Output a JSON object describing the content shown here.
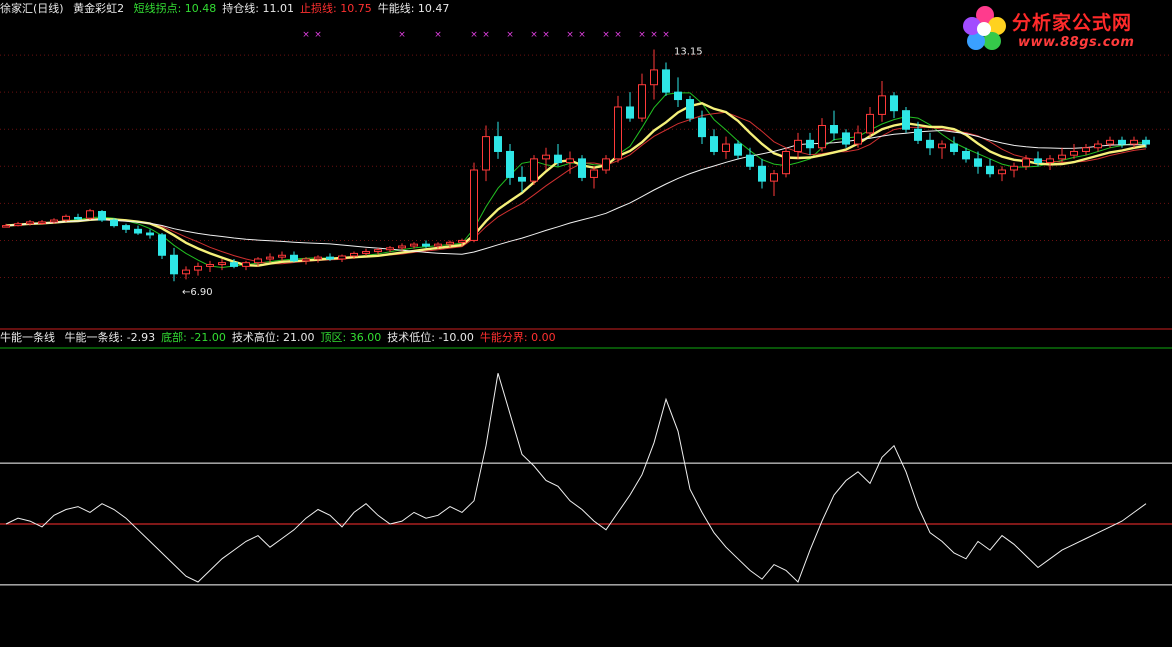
{
  "header_top": {
    "title": "徐家汇(日线)",
    "indicator": "黄金彩虹2",
    "items": [
      {
        "label": "短线拐点: ",
        "value": "10.48",
        "color": "#33dd33"
      },
      {
        "label": "持仓线: ",
        "value": "11.01",
        "color": "#e8e8e8"
      },
      {
        "label": "止损线: ",
        "value": "10.75",
        "color": "#ff3030"
      },
      {
        "label": "牛能线: ",
        "value": "10.47",
        "color": "#e8e8e8"
      }
    ]
  },
  "header_bottom": {
    "title": "牛能一条线",
    "items": [
      {
        "label": "牛能一条线: ",
        "value": "-2.93",
        "color": "#e8e8e8"
      },
      {
        "label": "底部: ",
        "value": "-21.00",
        "color": "#33dd33"
      },
      {
        "label": "技术高位: ",
        "value": "21.00",
        "color": "#e8e8e8"
      },
      {
        "label": "顶区: ",
        "value": "36.00",
        "color": "#33dd33"
      },
      {
        "label": "技术低位: ",
        "value": "-10.00",
        "color": "#e8e8e8"
      },
      {
        "label": "牛能分界: ",
        "value": "0.00",
        "color": "#ff3030"
      }
    ]
  },
  "logo": {
    "brand": "分析家公式网",
    "url": "www.88gs.com"
  },
  "chart_data": [
    {
      "type": "candlestick",
      "n_bars": 96,
      "ylim": [
        5.8,
        14.0
      ],
      "grid": "horizontal dotted red",
      "annotations": [
        {
          "text": "13.15",
          "bar": 55,
          "value": 13.15
        },
        {
          "text": "←6.90",
          "bar": 14,
          "value": 6.9
        }
      ],
      "marker_glyph": "×",
      "markers_bars": [
        25,
        26,
        33,
        36,
        39,
        40,
        42,
        44,
        45,
        47,
        48,
        50,
        51,
        53,
        54,
        55
      ],
      "candles": [
        [
          8.4,
          8.45,
          8.35,
          8.4
        ],
        [
          8.4,
          8.5,
          8.38,
          8.45
        ],
        [
          8.45,
          8.55,
          8.4,
          8.5
        ],
        [
          8.48,
          8.55,
          8.42,
          8.5
        ],
        [
          8.5,
          8.6,
          8.45,
          8.55
        ],
        [
          8.55,
          8.7,
          8.5,
          8.65
        ],
        [
          8.62,
          8.72,
          8.55,
          8.6
        ],
        [
          8.6,
          8.85,
          8.55,
          8.8
        ],
        [
          8.78,
          8.82,
          8.5,
          8.55
        ],
        [
          8.55,
          8.6,
          8.35,
          8.4
        ],
        [
          8.4,
          8.45,
          8.2,
          8.3
        ],
        [
          8.3,
          8.4,
          8.15,
          8.2
        ],
        [
          8.2,
          8.3,
          8.05,
          8.15
        ],
        [
          8.15,
          8.2,
          7.5,
          7.6
        ],
        [
          7.6,
          7.8,
          6.9,
          7.1
        ],
        [
          7.1,
          7.3,
          6.95,
          7.2
        ],
        [
          7.2,
          7.4,
          7.05,
          7.3
        ],
        [
          7.3,
          7.45,
          7.15,
          7.35
        ],
        [
          7.35,
          7.5,
          7.2,
          7.4
        ],
        [
          7.4,
          7.5,
          7.25,
          7.3
        ],
        [
          7.3,
          7.45,
          7.2,
          7.4
        ],
        [
          7.4,
          7.55,
          7.3,
          7.5
        ],
        [
          7.5,
          7.65,
          7.4,
          7.55
        ],
        [
          7.55,
          7.7,
          7.45,
          7.6
        ],
        [
          7.6,
          7.7,
          7.4,
          7.45
        ],
        [
          7.45,
          7.55,
          7.35,
          7.5
        ],
        [
          7.5,
          7.6,
          7.4,
          7.55
        ],
        [
          7.55,
          7.65,
          7.45,
          7.5
        ],
        [
          7.5,
          7.62,
          7.42,
          7.58
        ],
        [
          7.58,
          7.7,
          7.5,
          7.65
        ],
        [
          7.65,
          7.78,
          7.58,
          7.7
        ],
        [
          7.7,
          7.8,
          7.62,
          7.75
        ],
        [
          7.75,
          7.85,
          7.68,
          7.8
        ],
        [
          7.8,
          7.92,
          7.72,
          7.85
        ],
        [
          7.85,
          7.95,
          7.78,
          7.9
        ],
        [
          7.9,
          8.0,
          7.8,
          7.85
        ],
        [
          7.85,
          7.95,
          7.78,
          7.9
        ],
        [
          7.9,
          8.0,
          7.82,
          7.95
        ],
        [
          7.95,
          8.05,
          7.85,
          8.0
        ],
        [
          8.0,
          10.1,
          7.95,
          9.9
        ],
        [
          9.9,
          11.1,
          9.6,
          10.8
        ],
        [
          10.8,
          11.2,
          10.2,
          10.4
        ],
        [
          10.4,
          10.6,
          9.5,
          9.7
        ],
        [
          9.7,
          10.0,
          9.3,
          9.6
        ],
        [
          9.6,
          10.3,
          9.5,
          10.2
        ],
        [
          10.2,
          10.5,
          9.9,
          10.3
        ],
        [
          10.3,
          10.6,
          10.0,
          10.1
        ],
        [
          10.1,
          10.4,
          9.8,
          10.2
        ],
        [
          10.2,
          10.3,
          9.6,
          9.7
        ],
        [
          9.7,
          10.0,
          9.4,
          9.9
        ],
        [
          9.9,
          10.3,
          9.8,
          10.2
        ],
        [
          10.2,
          11.9,
          10.1,
          11.6
        ],
        [
          11.6,
          12.0,
          11.2,
          11.3
        ],
        [
          11.3,
          12.5,
          11.2,
          12.2
        ],
        [
          12.2,
          13.15,
          11.8,
          12.6
        ],
        [
          12.6,
          12.8,
          11.9,
          12.0
        ],
        [
          12.0,
          12.4,
          11.6,
          11.8
        ],
        [
          11.8,
          11.9,
          11.2,
          11.3
        ],
        [
          11.3,
          11.5,
          10.6,
          10.8
        ],
        [
          10.8,
          11.0,
          10.3,
          10.4
        ],
        [
          10.4,
          10.8,
          10.2,
          10.6
        ],
        [
          10.6,
          10.7,
          10.2,
          10.3
        ],
        [
          10.3,
          10.5,
          9.9,
          10.0
        ],
        [
          10.0,
          10.2,
          9.4,
          9.6
        ],
        [
          9.6,
          9.9,
          9.2,
          9.8
        ],
        [
          9.8,
          10.5,
          9.7,
          10.4
        ],
        [
          10.4,
          10.9,
          10.2,
          10.7
        ],
        [
          10.7,
          10.9,
          10.3,
          10.5
        ],
        [
          10.5,
          11.3,
          10.4,
          11.1
        ],
        [
          11.1,
          11.5,
          10.7,
          10.9
        ],
        [
          10.9,
          11.0,
          10.5,
          10.6
        ],
        [
          10.6,
          11.1,
          10.5,
          10.9
        ],
        [
          10.9,
          11.6,
          10.8,
          11.4
        ],
        [
          11.4,
          12.3,
          11.2,
          11.9
        ],
        [
          11.9,
          12.0,
          11.3,
          11.5
        ],
        [
          11.5,
          11.6,
          10.9,
          11.0
        ],
        [
          11.0,
          11.2,
          10.6,
          10.7
        ],
        [
          10.7,
          10.9,
          10.3,
          10.5
        ],
        [
          10.5,
          10.7,
          10.2,
          10.6
        ],
        [
          10.6,
          10.8,
          10.3,
          10.4
        ],
        [
          10.4,
          10.5,
          10.1,
          10.2
        ],
        [
          10.2,
          10.4,
          9.8,
          10.0
        ],
        [
          10.0,
          10.2,
          9.7,
          9.8
        ],
        [
          9.8,
          10.0,
          9.6,
          9.9
        ],
        [
          9.9,
          10.1,
          9.7,
          10.0
        ],
        [
          10.0,
          10.3,
          9.9,
          10.2
        ],
        [
          10.2,
          10.4,
          10.0,
          10.1
        ],
        [
          10.1,
          10.3,
          9.9,
          10.2
        ],
        [
          10.2,
          10.5,
          10.1,
          10.3
        ],
        [
          10.3,
          10.6,
          10.2,
          10.4
        ],
        [
          10.4,
          10.6,
          10.3,
          10.5
        ],
        [
          10.5,
          10.7,
          10.4,
          10.6
        ],
        [
          10.6,
          10.8,
          10.5,
          10.7
        ],
        [
          10.7,
          10.8,
          10.5,
          10.6
        ],
        [
          10.6,
          10.8,
          10.5,
          10.7
        ],
        [
          10.7,
          10.8,
          10.5,
          10.6
        ]
      ]
    },
    {
      "type": "line",
      "name": "牛能一条线",
      "ylim": [
        -40,
        60
      ],
      "reference_lines": [
        {
          "value": 21,
          "color": "#ffffff"
        },
        {
          "value": 0,
          "color": "#ff3030"
        },
        {
          "value": -21,
          "color": "#ffffff"
        }
      ],
      "values": [
        0,
        2,
        1,
        -1,
        3,
        5,
        6,
        4,
        7,
        5,
        2,
        -2,
        -6,
        -10,
        -14,
        -18,
        -20,
        -16,
        -12,
        -9,
        -6,
        -4,
        -8,
        -5,
        -2,
        2,
        5,
        3,
        -1,
        4,
        7,
        3,
        0,
        1,
        4,
        2,
        3,
        6,
        4,
        8,
        27,
        52,
        38,
        24,
        20,
        15,
        13,
        8,
        5,
        1,
        -2,
        4,
        10,
        17,
        28,
        43,
        32,
        12,
        4,
        -3,
        -8,
        -12,
        -16,
        -19,
        -14,
        -16,
        -20,
        -9,
        1,
        10,
        15,
        18,
        14,
        23,
        27,
        18,
        6,
        -3,
        -6,
        -10,
        -12,
        -6,
        -9,
        -4,
        -7,
        -11,
        -15,
        -12,
        -9,
        -7,
        -5,
        -3,
        -1,
        1,
        4,
        7
      ],
      "highlight_segments": [
        [
          4,
          7
        ],
        [
          21,
          24
        ],
        [
          26,
          28
        ],
        [
          29,
          36
        ],
        [
          38,
          42
        ],
        [
          51,
          51
        ],
        [
          55,
          57
        ],
        [
          74,
          74
        ],
        [
          76,
          78
        ],
        [
          80,
          83
        ],
        [
          94,
          95
        ]
      ],
      "highlight_color": "#ff33ff"
    }
  ]
}
